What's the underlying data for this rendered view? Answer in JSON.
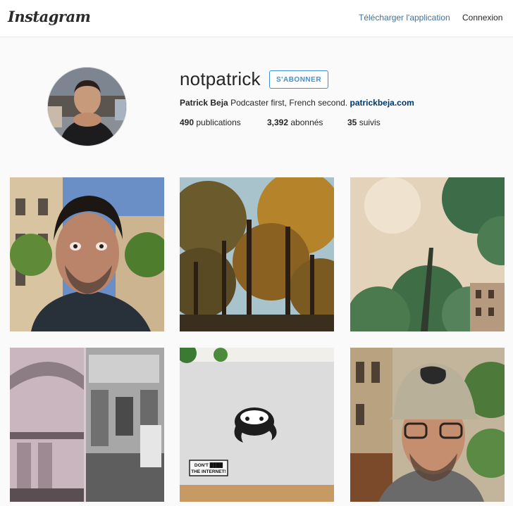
{
  "header": {
    "logo_text": "Instagram",
    "download_app_label": "Télécharger l'application",
    "login_label": "Connexion"
  },
  "profile": {
    "username": "notpatrick",
    "follow_button_label": "S'ABONNER",
    "full_name": "Patrick Beja",
    "bio": "Podcaster first, French second.",
    "website": "patrickbeja.com",
    "stats": {
      "posts_count": "490",
      "posts_label": "publications",
      "followers_count": "3,392",
      "followers_label": "abonnés",
      "following_count": "35",
      "following_label": "suivis"
    }
  },
  "posts": [
    {
      "description": "selfie-street-paris"
    },
    {
      "description": "autumn-trees"
    },
    {
      "description": "trees-looking-up"
    },
    {
      "description": "metro-station-bw"
    },
    {
      "description": "laptop-catbus-sticker",
      "sticker_text": "DON'T THE INTERNET!"
    },
    {
      "description": "selfie-cap-glasses"
    }
  ],
  "colors": {
    "link_blue": "#3f729b",
    "follow_blue": "#4090db",
    "website_blue": "#003569",
    "background": "#fafafa"
  }
}
